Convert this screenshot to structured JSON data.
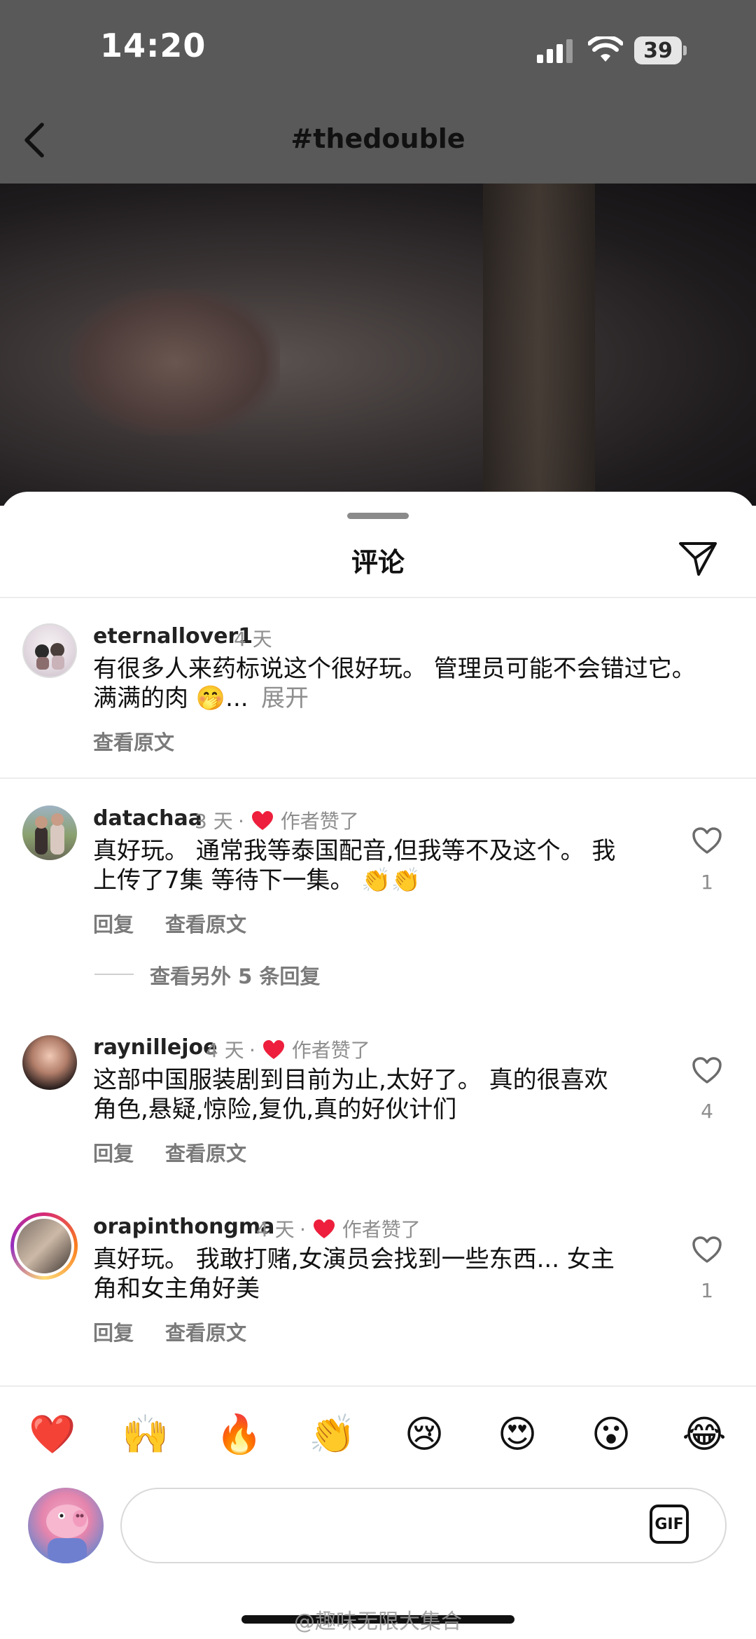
{
  "status_bar": {
    "time": "14:20",
    "battery": "39"
  },
  "header": {
    "title": "#thedouble"
  },
  "sheet": {
    "title": "评论"
  },
  "comments": [
    {
      "username": "eternallover1",
      "time": "4 天",
      "liked_by_author": "",
      "text_line1": "有很多人来药标说这个很好玩。 管理员可能不会错过它。",
      "text_line2": "满满的肉 🤭...",
      "expand": "展开",
      "reply": "",
      "translate": "查看原文",
      "likes": ""
    },
    {
      "username": "datachaa",
      "time": "3 天",
      "liked_by_author": "作者赞了",
      "text_line1": "真好玩。 通常我等泰国配音,但我等不及这个。 我",
      "text_line2": "上传了7集 等待下一集。 👏👏",
      "reply": "回复",
      "translate": "查看原文",
      "likes": "1"
    },
    {
      "username": "raynillejoe",
      "time": "4 天",
      "liked_by_author": "作者赞了",
      "text_line1": "这部中国服装剧到目前为止,太好了。 真的很喜欢",
      "text_line2": "角色,悬疑,惊险,复仇,真的好伙计们",
      "reply": "回复",
      "translate": "查看原文",
      "likes": "4"
    },
    {
      "username": "orapinthongma",
      "time": "4 天",
      "liked_by_author": "作者赞了",
      "text_line1": "真好玩。 我敢打赌,女演员会找到一些东西... 女主",
      "text_line2": "角和女主角好美",
      "reply": "回复",
      "translate": "查看原文",
      "likes": "1"
    }
  ],
  "more_replies": "查看另外 5 条回复",
  "emoji_bar": [
    "❤️",
    "🙌",
    "🔥",
    "👏",
    "😢",
    "😍",
    "😮",
    "😂"
  ],
  "composer": {
    "gif_label": "GIF"
  },
  "watermark": "@趣味无限大集合",
  "colors": {
    "like_red": "#ed1f3c",
    "top_bar": "#595959"
  }
}
